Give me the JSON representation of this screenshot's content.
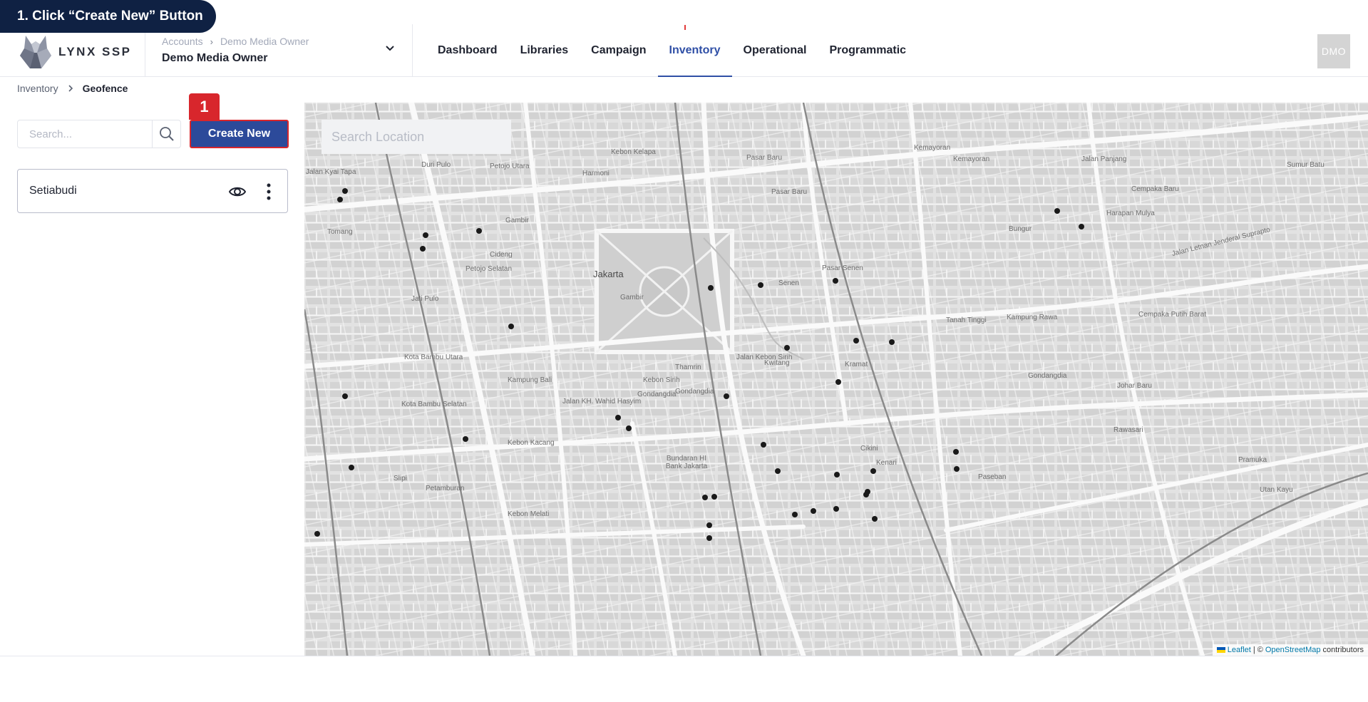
{
  "instruction": {
    "text": "1. Click “Create New” Button",
    "step_number": "1"
  },
  "header": {
    "logo_text": "LYNX SSP",
    "account_breadcrumb": [
      "Accounts",
      "Demo Media Owner"
    ],
    "account_name": "Demo Media Owner",
    "nav": [
      {
        "label": "Dashboard",
        "active": false
      },
      {
        "label": "Libraries",
        "active": false
      },
      {
        "label": "Campaign",
        "active": false
      },
      {
        "label": "Inventory",
        "active": true
      },
      {
        "label": "Operational",
        "active": false
      },
      {
        "label": "Programmatic",
        "active": false
      }
    ],
    "avatar_initials": "DMO"
  },
  "page_breadcrumb": {
    "parent": "Inventory",
    "current": "Geofence"
  },
  "sidebar": {
    "search_placeholder": "Search...",
    "create_label": "Create New",
    "items": [
      {
        "label": "Setiabudi"
      }
    ]
  },
  "map": {
    "search_placeholder": "Search Location",
    "labels": {
      "jakarta": "Jakarta",
      "gambir": "Gambir",
      "petojo_utara": "Petojo Utara",
      "petojo_selatan": "Petojo Selatan",
      "harmoni": "Harmoni",
      "kebon_kelapa": "Kebon Kelapa",
      "pasar_baru": "Pasar Baru",
      "kemayoran": "Kemayoran",
      "jalan_panjang": "Jalan Panjang",
      "cempaka_baru": "Cempaka Baru",
      "harapan_mulya": "Harapan Mulya",
      "bungur": "Bungur",
      "senen": "Senen",
      "kwitang": "Kwitang",
      "kramat": "Kramat",
      "tanah_tinggi": "Tanah Tinggi",
      "kampung_rawa": "Kampung Rawa",
      "cempaka_putih_barat": "Cempaka Putih Barat",
      "johar_baru": "Johar Baru",
      "gondangdia": "Gondangdia",
      "cikini": "Cikini",
      "kenari": "Kenari",
      "kebon_sirih": "Kebon Sirih",
      "kampung_bali": "Kampung Bali",
      "kebon_kacang": "Kebon Kacang",
      "kebon_melati": "Kebon Melati",
      "petamburan": "Petamburan",
      "kota_bambu_utara": "Kota Bambu Utara",
      "kota_bambu_selatan": "Kota Bambu Selatan",
      "jati_pulo": "Jati Pulo",
      "tomang": "Tomang",
      "duri_pulo": "Duri Pulo",
      "cideng": "Cideng",
      "slipi": "Slipi",
      "thamrin": "Thamrin",
      "pasar_senen": "Pasar Senen",
      "paseban": "Paseban",
      "rawasari": "Rawasari",
      "pramuka": "Pramuka",
      "utan_kayu": "Utan Kayu",
      "sumur_batu": "Sumur Batu",
      "jalan_kyai_tapa": "Jalan Kyai Tapa",
      "jalan_kebon_sirih": "Jalan Kebon Sirih",
      "jalan_kh_wahid_hasyim": "Jalan KH. Wahid Hasyim",
      "bundaran_hi": "Bundaran HI Bank Jakarta",
      "jalan_letjen_suprapto": "Jalan Letnan Jenderal Suprapto"
    },
    "attribution": {
      "leaflet": "Leaflet",
      "separator": "| ©",
      "osm": "OpenStreetMap",
      "suffix": "contributors"
    }
  }
}
